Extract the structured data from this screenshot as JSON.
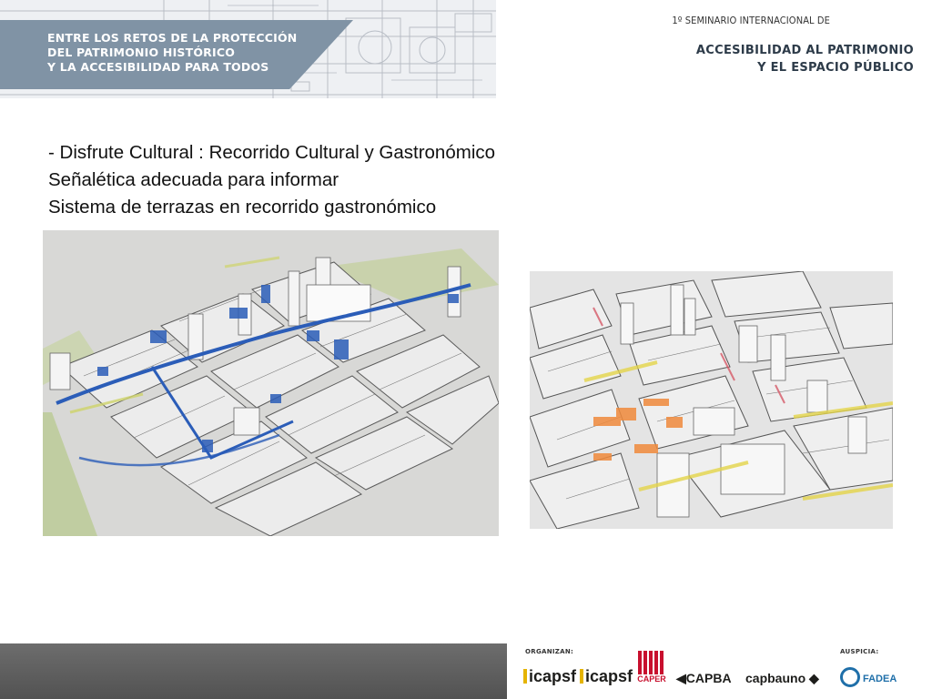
{
  "header": {
    "banner_lines": [
      "ENTRE LOS RETOS DE LA PROTECCIÓN",
      "DEL PATRIMONIO HISTÓRICO",
      "Y LA ACCESIBILIDAD PARA TODOS"
    ],
    "seminar_label": "1º SEMINARIO INTERNACIONAL DE",
    "event_lines": [
      "ACCESIBILIDAD AL PATRIMONIO",
      "Y EL ESPACIO PÚBLICO"
    ]
  },
  "content": {
    "lines": [
      "- Disfrute Cultural : Recorrido Cultural y Gastronómico",
      "Señalética adecuada para informar",
      "Sistema de terrazas en recorrido gastronómico"
    ]
  },
  "images": {
    "left_icon": "urban-model-blue-route",
    "right_icon": "urban-model-orange-terraces"
  },
  "footer": {
    "organizan_label": "ORGANIZAN:",
    "auspicia_label": "AUSPICIA:",
    "logos": {
      "ica1": "icapsf",
      "ica2": "icapsf",
      "caper": "CAPER",
      "capba": "CAPBA",
      "capbauno": "capbauno",
      "fadea": "FADEA"
    }
  },
  "colors": {
    "banner": "#8093a5",
    "event_text": "#2d3b49",
    "footer": "#5f5f5f",
    "route_blue": "#2b5db8",
    "terrace_orange": "#f08a3c"
  }
}
